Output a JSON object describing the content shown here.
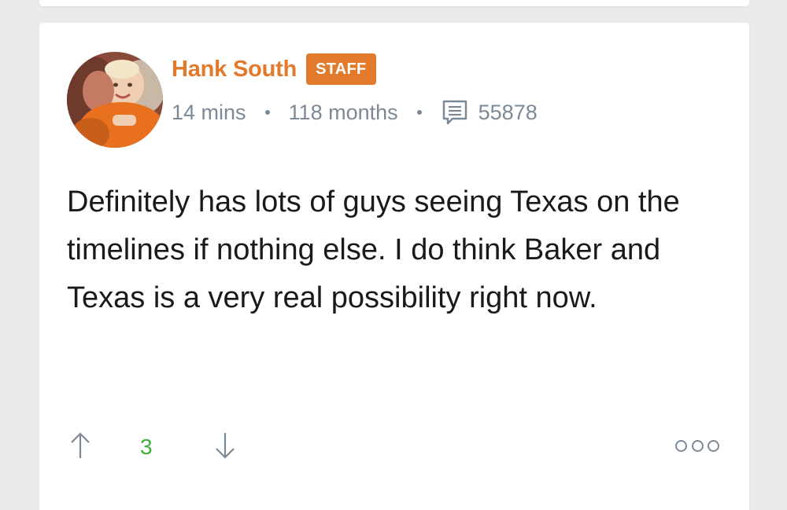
{
  "post": {
    "author": "Hank South",
    "badge": "STAFF",
    "time_ago": "14 mins",
    "member_for": "118 months",
    "post_count": "55878",
    "body": "Definitely has lots of guys seeing Texas on the timelines if nothing else. I do think Baker and Texas is a very real possibility right now.",
    "score": "3"
  },
  "icons": {
    "posts": "posts-icon",
    "upvote": "arrow-up-icon",
    "downvote": "arrow-down-icon",
    "more": "more-options-icon"
  },
  "colors": {
    "accent": "#e27a2c",
    "meta": "#7c8a97",
    "score": "#3fae3a",
    "text": "#1a1a1a",
    "background": "#ebebeb"
  }
}
